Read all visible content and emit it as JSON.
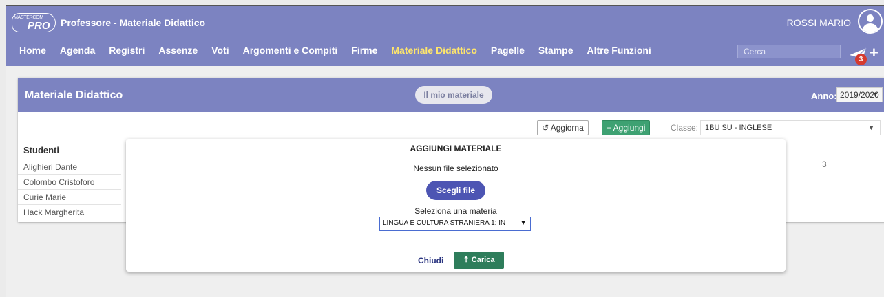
{
  "header": {
    "logo_top": "MASTERCOM",
    "logo_bottom": "PRO",
    "title": "Professore - Materiale Didattico",
    "user": "ROSSI MARIO",
    "search_placeholder": "Cerca",
    "notification_count": "3"
  },
  "nav": {
    "items": [
      {
        "label": "Home"
      },
      {
        "label": "Agenda"
      },
      {
        "label": "Registri"
      },
      {
        "label": "Assenze"
      },
      {
        "label": "Voti"
      },
      {
        "label": "Argomenti e Compiti"
      },
      {
        "label": "Firme"
      },
      {
        "label": "Materiale Didattico",
        "active": true
      },
      {
        "label": "Pagelle"
      },
      {
        "label": "Stampe"
      },
      {
        "label": "Altre Funzioni"
      }
    ]
  },
  "panel": {
    "title": "Materiale Didattico",
    "my_material_label": "Il mio materiale",
    "year_label": "Anno:",
    "year_value": "2019/2020",
    "refresh_label": "↺ Aggiorna",
    "add_label": "+ Aggiungi",
    "class_label": "Classe:",
    "class_value": "1BU SU - INGLESE",
    "students_header": "Studenti",
    "students": [
      "Alighieri Dante",
      "Colombo Cristoforo",
      "Curie Marie",
      "Hack Margherita"
    ],
    "cell_value": "3"
  },
  "modal": {
    "title": "AGGIUNGI MATERIALE",
    "no_file": "Nessun file selezionato",
    "choose_file": "Scegli file",
    "select_label": "Seleziona una materia",
    "subject_value": "LINGUA E CULTURA STRANIERA 1: IN",
    "close_label": "Chiudi",
    "upload_label": "⇡ Carica"
  },
  "colors": {
    "header_bg": "#7c83c1",
    "active_nav": "#ffe66b",
    "primary_button": "#4d55b3",
    "success_button": "#2e7d5b",
    "badge": "#d63a2f"
  }
}
